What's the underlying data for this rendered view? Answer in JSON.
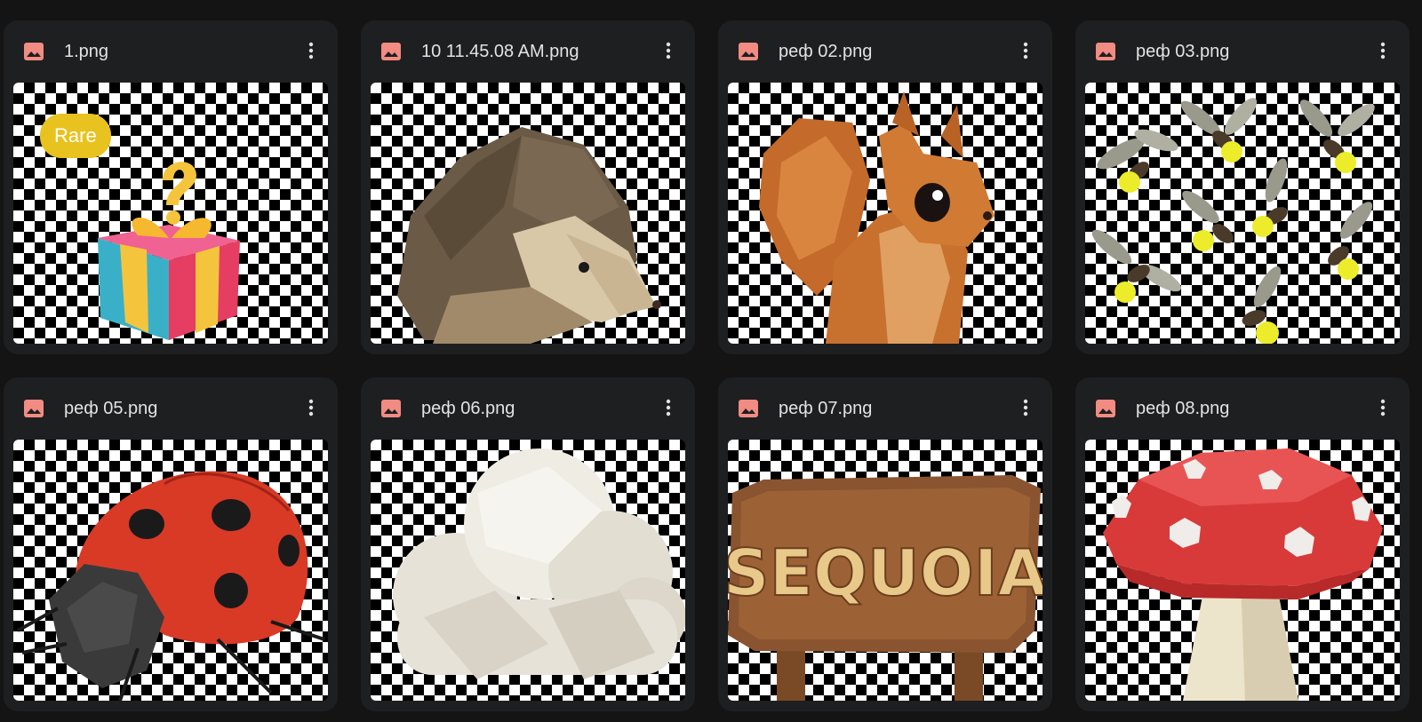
{
  "files": [
    {
      "name": "1.png",
      "badge": "Rare",
      "art": "gift-box"
    },
    {
      "name": "10 11.45.08 AM.png",
      "art": "hedgehog"
    },
    {
      "name": "реф 02.png",
      "art": "squirrel"
    },
    {
      "name": "реф 03.png",
      "art": "fireflies"
    },
    {
      "name": "реф 05.png",
      "art": "ladybug"
    },
    {
      "name": "реф 06.png",
      "art": "cloud"
    },
    {
      "name": "реф 07.png",
      "art": "sign",
      "sign_text": "SEQUOIA"
    },
    {
      "name": "реф 08.png",
      "art": "mushroom"
    }
  ],
  "icons": {
    "file_type": "image-icon",
    "menu": "more-vert-icon"
  },
  "colors": {
    "background": "#141414",
    "card": "#1e1f20",
    "file_icon": "#f28b82",
    "badge": "#e8c21f"
  }
}
